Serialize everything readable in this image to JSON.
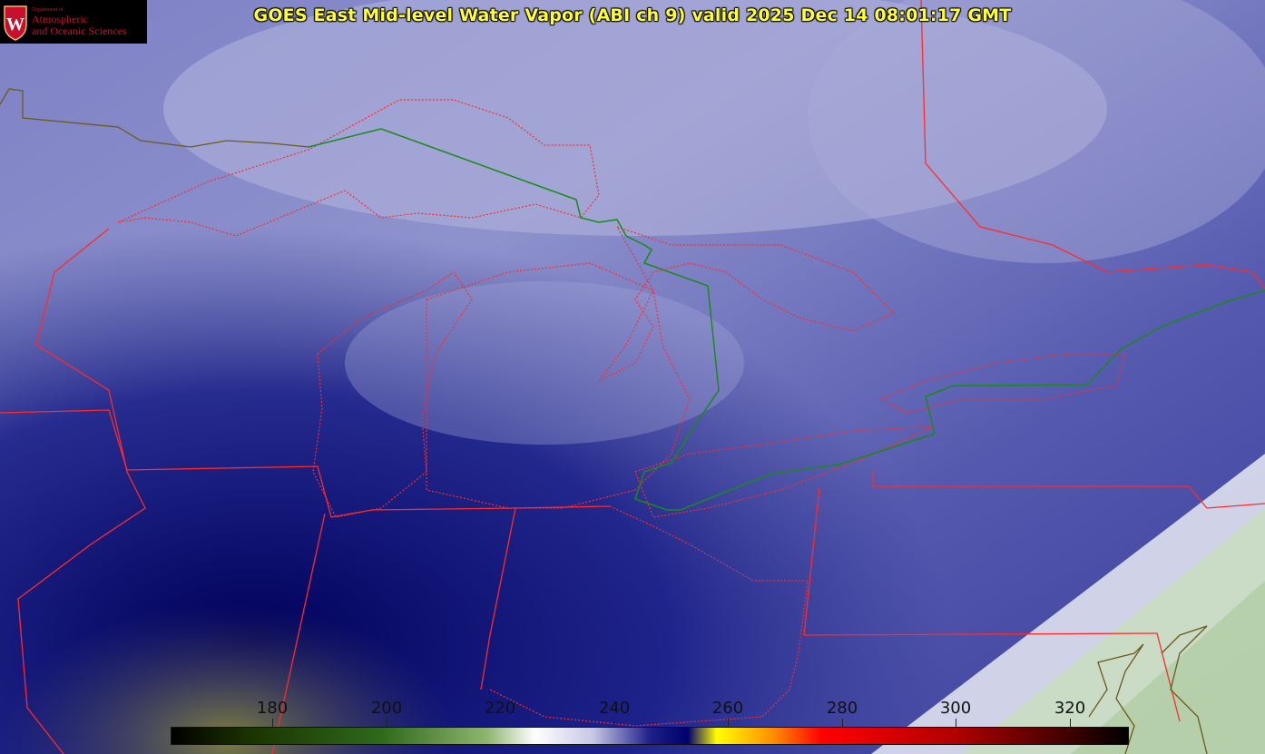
{
  "title": "GOES East Mid-level Water Vapor (ABI ch 9)  valid 2025 Dec 14 08:01:17 GMT",
  "logo": {
    "line1": "Department of",
    "line2": "Atmospheric",
    "line3": "and Oceanic Sciences",
    "icon": "uw-crest-icon"
  },
  "colorbar": {
    "ticks": [
      "180",
      "200",
      "220",
      "240",
      "260",
      "280",
      "300",
      "320"
    ]
  },
  "colors": {
    "title": "#ffff33",
    "state_borders": "#ff2a2a",
    "intl_border": "#1a8a1a",
    "coastline": "#6b5a1a"
  }
}
